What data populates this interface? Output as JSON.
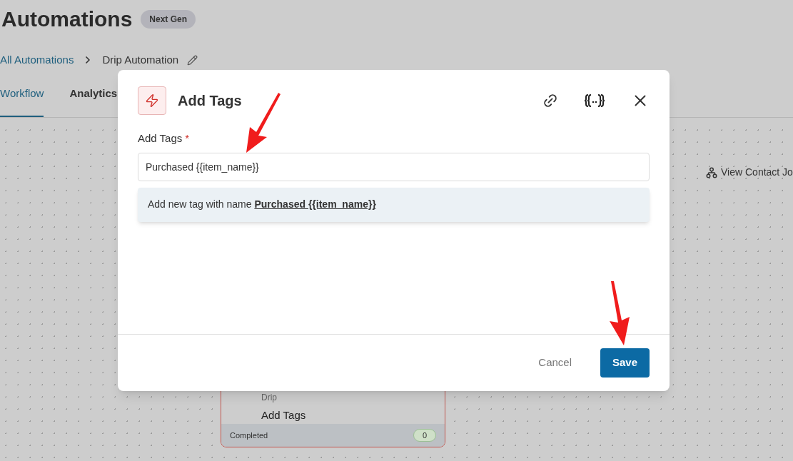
{
  "page": {
    "title": "Automations",
    "badge": "Next Gen"
  },
  "breadcrumb": [
    {
      "label": "All Automations",
      "kind": "link"
    },
    {
      "label": "Drip Automation",
      "kind": "current"
    }
  ],
  "tabs": [
    {
      "label": "Workflow",
      "selected": true
    },
    {
      "label": "Analytics",
      "selected": false
    }
  ],
  "canvas": {
    "view_link": "View Contact Jo",
    "node": {
      "subtitle": "Drip",
      "title": "Add Tags",
      "status": "Completed",
      "count": "0"
    }
  },
  "modal": {
    "title": "Add Tags",
    "field": {
      "label": "Add Tags",
      "required": true,
      "required_mark": "*",
      "value": "Purchased {{item_name}}"
    },
    "suggestion": {
      "text": "Add new tag with name",
      "tag": "Purchased {{item_name}}"
    },
    "cancel": "Cancel",
    "save": "Save"
  }
}
